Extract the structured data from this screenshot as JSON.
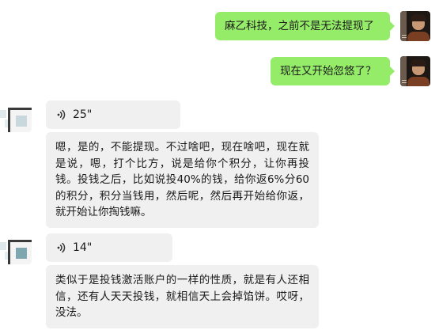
{
  "messages": [
    {
      "sender": "self",
      "type": "text",
      "text": "麻乙科技，之前不是无法提现了"
    },
    {
      "sender": "self",
      "type": "text",
      "text": "现在又开始忽悠了？"
    },
    {
      "sender": "other",
      "type": "voice",
      "duration": "25\""
    },
    {
      "sender": "other",
      "type": "text",
      "text": "嗯，是的，不能提现。不过啥吧，现在啥吧，现在就是说，嗯，打个比方，说是给你个积分，让你再投钱。投钱之后，比如说投40%的钱，给你返6%分60的积分，积分当钱用，然后呢，然后再开始给你返，就开始让你掏钱嘛。"
    },
    {
      "sender": "other",
      "type": "voice",
      "duration": "14\""
    },
    {
      "sender": "other",
      "type": "text",
      "text": "类似于是投钱激活账户的一样的性质，就是有人还相信，还有人天天投钱，就相信天上会掉馅饼。哎呀，没法。"
    }
  ],
  "icons": {
    "voice": "voice-wave-icon",
    "self_avatar": "user-photo-avatar",
    "other_avatar": "pixel-square-avatar"
  },
  "colors": {
    "outgoing_bubble": "#95ec69",
    "incoming_bubble": "#f0f0f0",
    "background": "#ffffff"
  }
}
